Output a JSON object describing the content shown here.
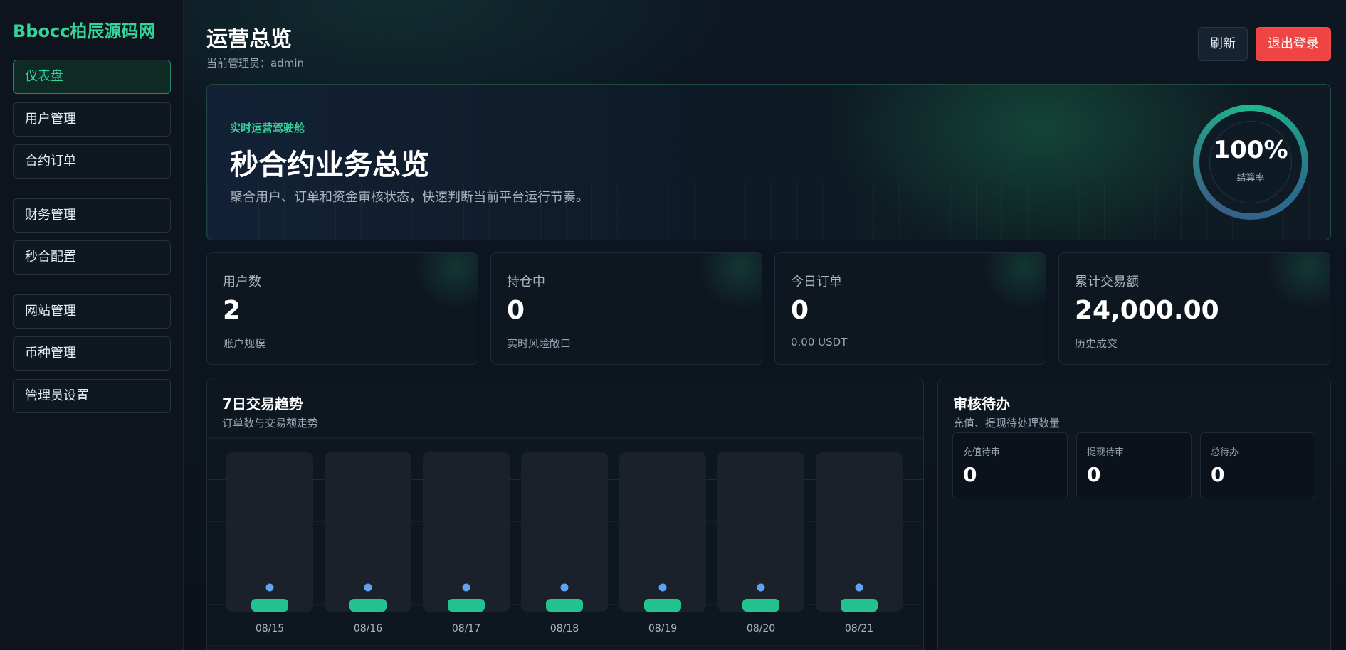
{
  "brand": "Bbocc柏辰源码网",
  "sidebar": {
    "items": [
      {
        "label": "仪表盘",
        "active": true
      },
      {
        "label": "用户管理"
      },
      {
        "label": "合约订单"
      },
      {
        "label": "财务管理"
      },
      {
        "label": "秒合配置"
      },
      {
        "label": "网站管理"
      },
      {
        "label": "币种管理"
      },
      {
        "label": "管理员设置"
      }
    ]
  },
  "header": {
    "title": "运营总览",
    "subtitle": "当前管理员：admin",
    "refresh_label": "刷新",
    "logout_label": "退出登录"
  },
  "hero": {
    "eyebrow": "实时运营驾驶舱",
    "title": "秒合约业务总览",
    "description": "聚合用户、订单和资金审核状态，快速判断当前平台运行节奏。",
    "ring_value": "100%",
    "ring_label": "结算率"
  },
  "stats": [
    {
      "label": "用户数",
      "value": "2",
      "sub": "账户规模"
    },
    {
      "label": "持仓中",
      "value": "0",
      "sub": "实时风险敞口"
    },
    {
      "label": "今日订单",
      "value": "0",
      "sub": "0.00 USDT"
    },
    {
      "label": "累计交易额",
      "value": "24,000.00",
      "sub": "历史成交"
    }
  ],
  "trend_panel": {
    "title": "7日交易趋势",
    "subtitle": "订单数与交易额走势"
  },
  "review_panel": {
    "title": "审核待办",
    "subtitle": "充值、提现待处理数量",
    "items": [
      {
        "label": "充值待审",
        "value": "0"
      },
      {
        "label": "提现待审",
        "value": "0"
      },
      {
        "label": "总待办",
        "value": "0"
      }
    ]
  },
  "chart_data": {
    "type": "bar",
    "title": "7日交易趋势",
    "categories": [
      "08/15",
      "08/16",
      "08/17",
      "08/18",
      "08/19",
      "08/20",
      "08/21"
    ],
    "series": [
      {
        "name": "订单数",
        "values": [
          0,
          0,
          0,
          0,
          0,
          0,
          0
        ]
      },
      {
        "name": "交易额",
        "values": [
          0,
          0,
          0,
          0,
          0,
          0,
          0
        ]
      }
    ],
    "colors": {
      "bar": "#22c38e",
      "dot": "#5ea2f2",
      "track": "#1a212b"
    },
    "grid": true
  }
}
